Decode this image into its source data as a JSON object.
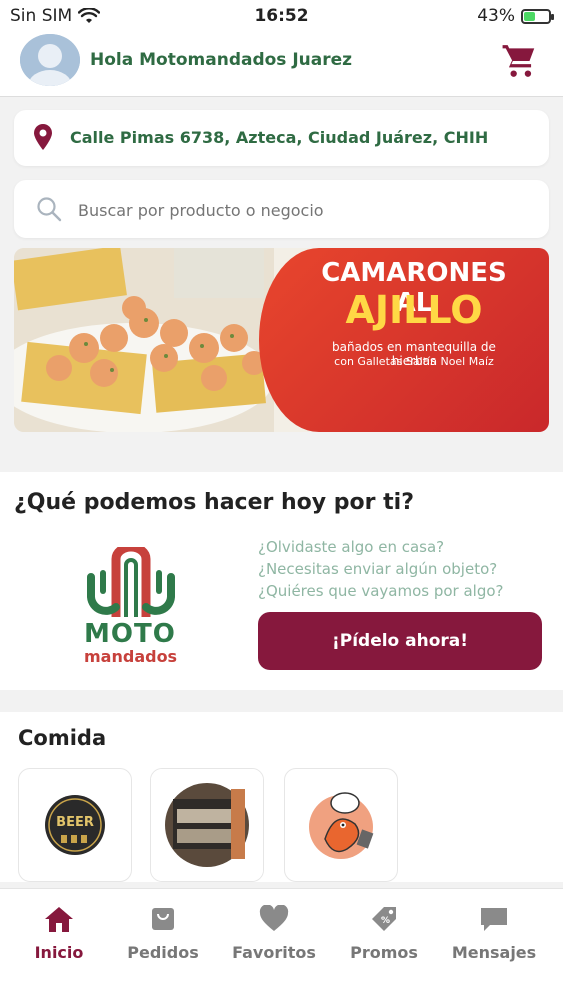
{
  "status": {
    "carrier": "Sin SIM",
    "time": "16:52",
    "battery": "43%",
    "battery_level": 0.43
  },
  "header": {
    "greeting": "Hola Motomandados Juarez"
  },
  "address": {
    "text": "Calle Pimas 6738, Azteca, Ciudad Juárez, CHIH"
  },
  "search": {
    "placeholder": "Buscar por producto o negocio"
  },
  "banner": {
    "title_line1": "CAMARONES AL",
    "title_line2": "AJILLO",
    "subtitle1": "bañados en mantequilla de hierbas",
    "subtitle2": "con Galletas Saltín Noel Maíz"
  },
  "service": {
    "heading": "¿Qué podemos hacer hoy por ti?",
    "logo_top": "MOTO",
    "logo_bottom": "mandados",
    "questions": [
      "¿Olvidaste algo en casa?",
      "¿Necesitas enviar algún objeto?",
      "¿Quiéres que vayamos por algo?"
    ],
    "cta": "¡Pídelo ahora!"
  },
  "food": {
    "heading": "Comida",
    "tile1_text": "BEER"
  },
  "tabs": [
    {
      "label": "Inicio",
      "icon": "home-icon"
    },
    {
      "label": "Pedidos",
      "icon": "bag-icon"
    },
    {
      "label": "Favoritos",
      "icon": "heart-icon"
    },
    {
      "label": "Promos",
      "icon": "tag-icon"
    },
    {
      "label": "Mensajes",
      "icon": "chat-icon"
    }
  ],
  "colors": {
    "brand": "#86183d",
    "green": "#2f6b43",
    "question": "#8fb6a3",
    "banner_red": "#d9352b"
  }
}
